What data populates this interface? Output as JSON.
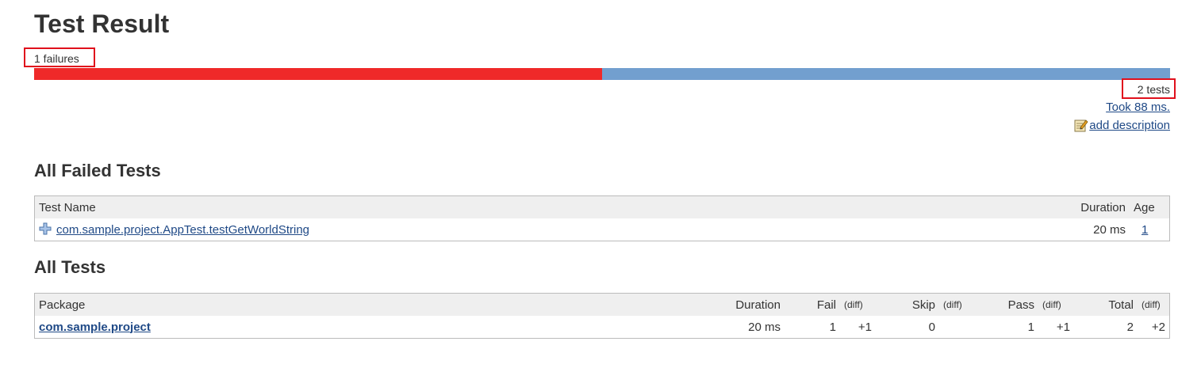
{
  "page_title": "Test Result",
  "failures_text": "1 failures",
  "progress": {
    "failed": 1,
    "total": 2,
    "fail_fraction": 0.5,
    "fail_color": "#ef2929",
    "pass_color": "#729fcf"
  },
  "tests_text": "2 tests",
  "took_text": "Took 88 ms.",
  "add_description": {
    "icon": "edit-icon",
    "label": "add description"
  },
  "failed_section": {
    "title": "All Failed Tests",
    "headers": {
      "name": "Test Name",
      "duration": "Duration",
      "age": "Age"
    },
    "rows": [
      {
        "icon": "expand-plus-icon",
        "name": "com.sample.project.AppTest.testGetWorldString",
        "duration": "20 ms",
        "age": "1"
      }
    ]
  },
  "all_section": {
    "title": "All Tests",
    "headers": {
      "package": "Package",
      "duration": "Duration",
      "fail": "Fail",
      "skip": "Skip",
      "pass": "Pass",
      "total": "Total",
      "diff": "(diff)"
    },
    "rows": [
      {
        "package": "com.sample.project",
        "duration": "20 ms",
        "fail": "1",
        "fail_diff": "+1",
        "skip": "0",
        "skip_diff": "",
        "pass": "1",
        "pass_diff": "+1",
        "total": "2",
        "total_diff": "+2"
      }
    ]
  },
  "highlight_color": "#e0101c"
}
